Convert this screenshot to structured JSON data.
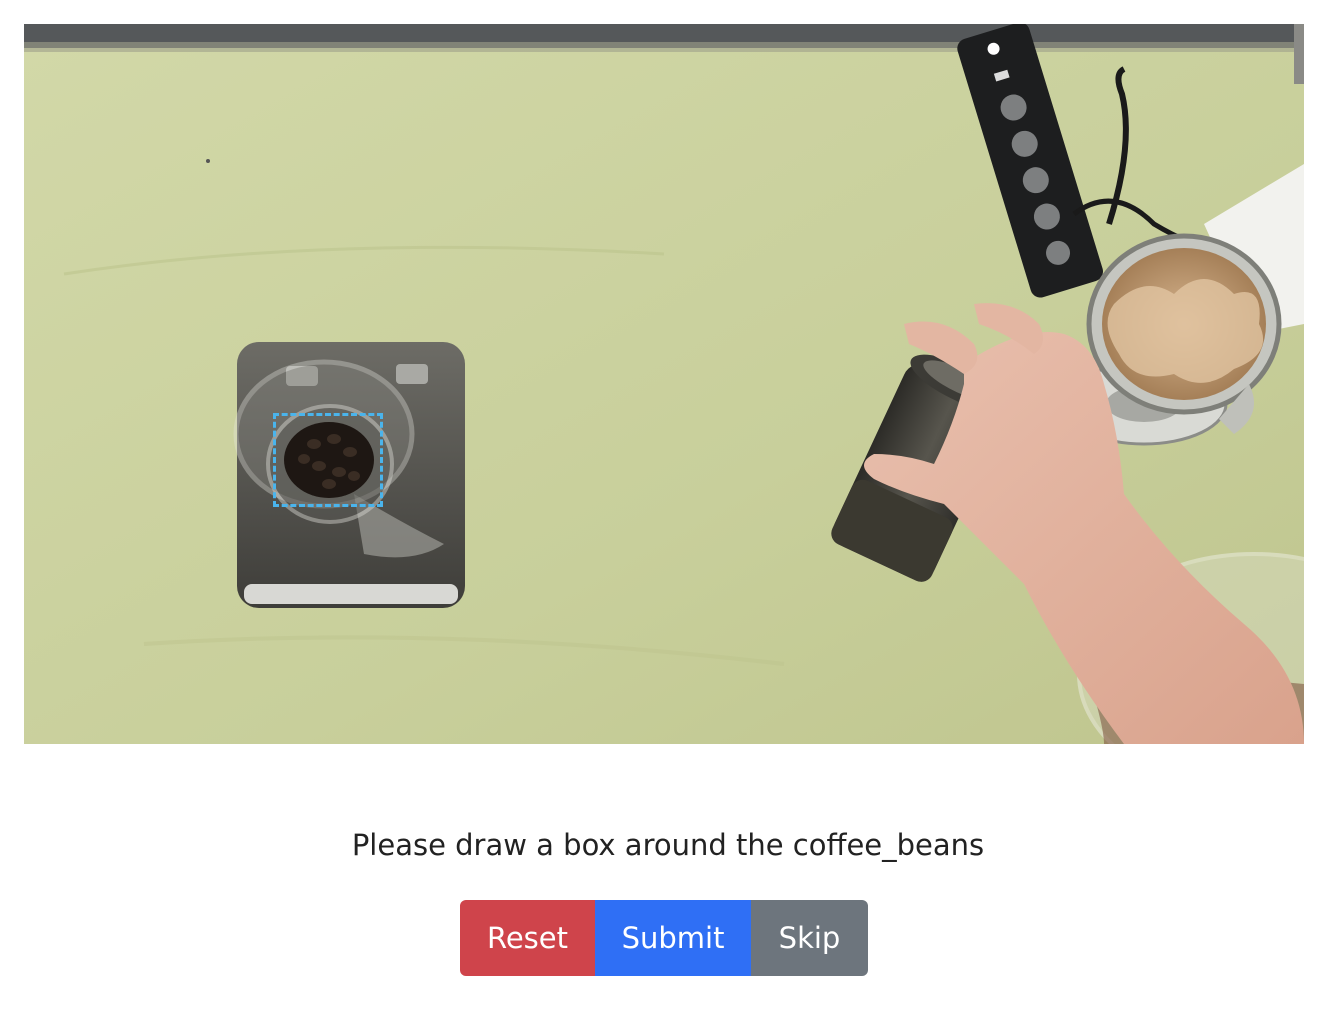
{
  "task": {
    "instruction": "Please draw a box around the coffee_beans"
  },
  "buttons": {
    "reset_label": "Reset",
    "submit_label": "Submit",
    "skip_label": "Skip"
  },
  "colors": {
    "reset": "#cf444b",
    "submit": "#2f6ff5",
    "skip": "#6d757d",
    "bbox_stroke": "#4ab4ec",
    "tablecloth": "#ccd2a1"
  }
}
